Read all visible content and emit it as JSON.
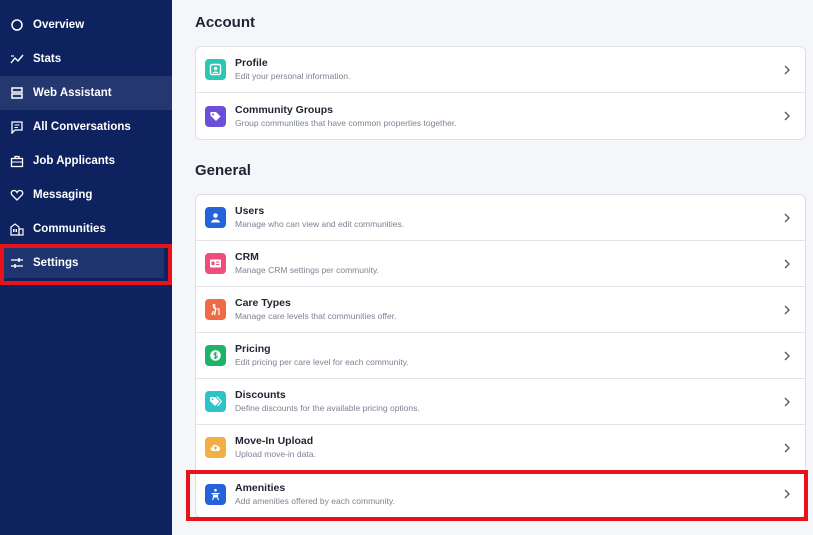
{
  "sidebar": {
    "items": [
      {
        "label": "Overview",
        "icon": "circle-outline-icon"
      },
      {
        "label": "Stats",
        "icon": "chart-line-icon"
      },
      {
        "label": "Web Assistant",
        "icon": "server-icon"
      },
      {
        "label": "All Conversations",
        "icon": "chat-icon"
      },
      {
        "label": "Job Applicants",
        "icon": "briefcase-icon"
      },
      {
        "label": "Messaging",
        "icon": "heart-icon"
      },
      {
        "label": "Communities",
        "icon": "building-icon"
      },
      {
        "label": "Settings",
        "icon": "sliders-icon"
      }
    ]
  },
  "account": {
    "title": "Account",
    "rows": [
      {
        "title": "Profile",
        "desc": "Edit your personal information.",
        "color": "#2dc6b5",
        "icon": "profile-card-icon"
      },
      {
        "title": "Community Groups",
        "desc": "Group communities that have common properties together.",
        "color": "#6b4fd8",
        "icon": "tag-icon"
      }
    ]
  },
  "general": {
    "title": "General",
    "rows": [
      {
        "title": "Users",
        "desc": "Manage who can view and edit communities.",
        "color": "#2563d9",
        "icon": "user-icon"
      },
      {
        "title": "CRM",
        "desc": "Manage CRM settings per community.",
        "color": "#ef4d7e",
        "icon": "id-card-icon"
      },
      {
        "title": "Care Types",
        "desc": "Manage care levels that communities offer.",
        "color": "#ef6a45",
        "icon": "walker-icon"
      },
      {
        "title": "Pricing",
        "desc": "Edit pricing per care level for each community.",
        "color": "#1fb36a",
        "icon": "dollar-icon"
      },
      {
        "title": "Discounts",
        "desc": "Define discounts for the available pricing options.",
        "color": "#2ec2c9",
        "icon": "tags-icon"
      },
      {
        "title": "Move-In Upload",
        "desc": "Upload move-in data.",
        "color": "#f0b043",
        "icon": "cloud-upload-icon"
      },
      {
        "title": "Amenities",
        "desc": "Add amenities offered by each community.",
        "color": "#2563d9",
        "icon": "amenities-icon"
      }
    ]
  },
  "colors": {
    "sidebar": "#0f2260",
    "highlight": "#e8121b"
  }
}
